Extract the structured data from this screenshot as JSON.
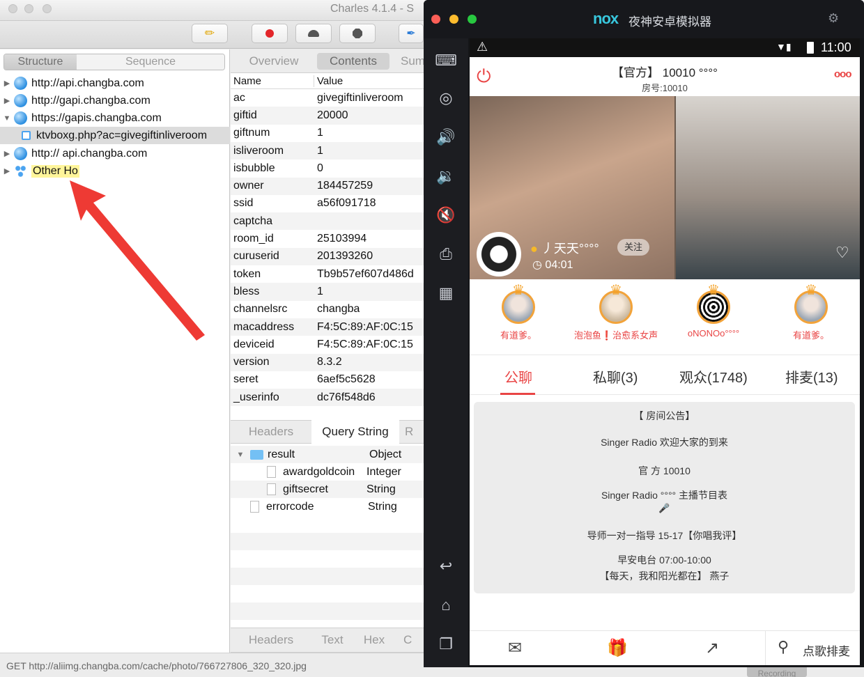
{
  "charles": {
    "window_title": "Charles 4.1.4 - S",
    "view_tabs": [
      "Structure",
      "Sequence"
    ],
    "detail_tabs": [
      "Overview",
      "Contents",
      "Sum"
    ],
    "tree": [
      {
        "expanded": false,
        "label": "http://api.changba.com"
      },
      {
        "expanded": false,
        "label": "http://gapi.changba.com"
      },
      {
        "expanded": true,
        "label": "https://gapis.changba.com"
      },
      {
        "child": true,
        "label": "ktvboxg.php?ac=givegiftinliveroom"
      },
      {
        "expanded": false,
        "label": "http://    api.changba.com"
      },
      {
        "expanded": false,
        "label": "Other Ho"
      }
    ],
    "kv_header": {
      "name": "Name",
      "value": "Value"
    },
    "kv": [
      {
        "k": "ac",
        "v": "givegiftinliveroom"
      },
      {
        "k": "giftid",
        "v": "20000"
      },
      {
        "k": "giftnum",
        "v": "1"
      },
      {
        "k": "isliveroom",
        "v": "1"
      },
      {
        "k": "isbubble",
        "v": "0"
      },
      {
        "k": "owner",
        "v": "184457259"
      },
      {
        "k": "ssid",
        "v": "a56f091718"
      },
      {
        "k": "captcha",
        "v": ""
      },
      {
        "k": "room_id",
        "v": "25103994"
      },
      {
        "k": "curuserid",
        "v": "201393260"
      },
      {
        "k": "token",
        "v": "Tb9b57ef607d486d"
      },
      {
        "k": "bless",
        "v": "1"
      },
      {
        "k": "channelsrc",
        "v": "changba"
      },
      {
        "k": "macaddress",
        "v": "F4:5C:89:AF:0C:15"
      },
      {
        "k": "deviceid",
        "v": "F4:5C:89:AF:0C:15"
      },
      {
        "k": "version",
        "v": "8.3.2"
      },
      {
        "k": "seret",
        "v": "6aef5c5628"
      },
      {
        "k": "_userinfo",
        "v": "dc76f548d6"
      }
    ],
    "req_tabs": [
      "Headers",
      "Query String",
      "R"
    ],
    "result_tree": [
      {
        "indent": 0,
        "folder": true,
        "name": "result",
        "type": "Object"
      },
      {
        "indent": 1,
        "folder": false,
        "name": "awardgoldcoin",
        "type": "Integer"
      },
      {
        "indent": 1,
        "folder": false,
        "name": "giftsecret",
        "type": "String"
      },
      {
        "indent": 0,
        "folder": false,
        "name": "errorcode",
        "type": "String"
      }
    ],
    "resp_tabs": [
      "Headers",
      "Text",
      "Hex",
      "C"
    ],
    "status_text": "GET http://aliimg.changba.com/cache/photo/766727806_320_320.jpg",
    "recording_text": "Recording"
  },
  "nox": {
    "brand": "nox",
    "title": "夜神安卓模拟器",
    "time": "11:00",
    "room_title": "【官方】 10010 °°°°",
    "room_no": "房号:10010",
    "more": "ooo",
    "host_name": "丿天天°°°°",
    "follow": "关注",
    "timer": "04:01",
    "gifts": [
      {
        "name": "有道爹。"
      },
      {
        "name": "泡泡鱼❗治愈系女声"
      },
      {
        "name": "oNONOo°°°°"
      },
      {
        "name": "有道爹。"
      }
    ],
    "tabs": [
      "公聊",
      "私聊(3)",
      "观众(1748)",
      "排麦(13)"
    ],
    "notice": [
      "【 房间公告】",
      "Singer Radio 欢迎大家的到来",
      "官 方 10010",
      "Singer Radio °°°° 主播节目表",
      "导师一对一指导    15-17【你唱我评】",
      "早安电台    07:00-10:00",
      "【每天，我和阳光都在】  燕子"
    ],
    "order_song": "点歌排麦",
    "colors": {
      "accent": "#e94545",
      "side": "#1c1d21"
    }
  }
}
